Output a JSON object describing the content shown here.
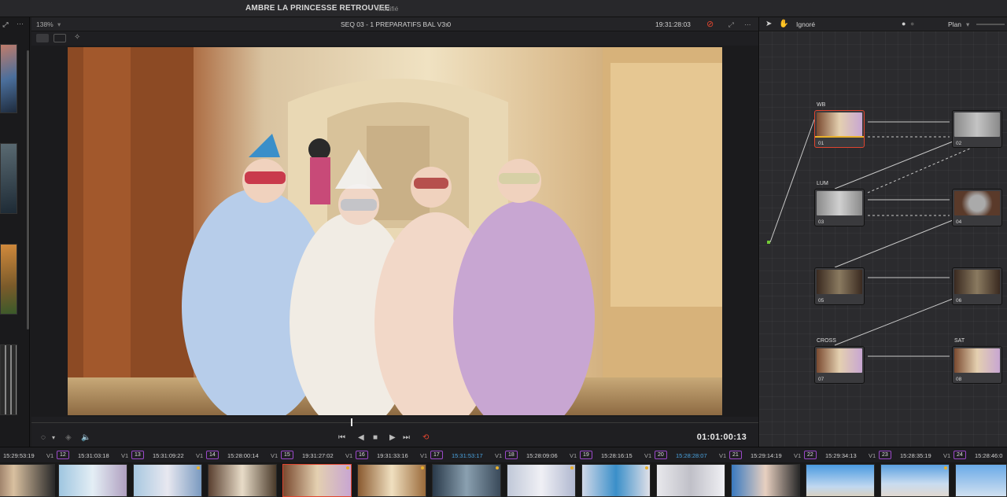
{
  "app": {
    "project_title": "AMBRE LA PRINCESSE RETROUVEE",
    "status": "Modifié"
  },
  "viewer": {
    "zoom": "138%",
    "clip_name": "SEQ 03 - 1 PREPARATIFS BAL V3.0",
    "source_timecode": "19:31:28:03",
    "record_timecode": "01:01:00:13"
  },
  "node_editor": {
    "mode": "Ignoré",
    "view": "Plan"
  },
  "nodes": [
    {
      "id": "01",
      "label": "WB",
      "selected": true
    },
    {
      "id": "02",
      "label": ""
    },
    {
      "id": "03",
      "label": "LUM"
    },
    {
      "id": "04",
      "label": ""
    },
    {
      "id": "05",
      "label": ""
    },
    {
      "id": "06",
      "label": ""
    },
    {
      "id": "07",
      "label": "CROSS"
    },
    {
      "id": "08",
      "label": "SAT"
    }
  ],
  "clips": [
    {
      "timecode": "15:29:53:19",
      "track": "V1",
      "number": "12"
    },
    {
      "timecode": "15:31:03:18",
      "track": "V1",
      "number": "13"
    },
    {
      "timecode": "15:31:09:22",
      "track": "V1",
      "number": "14"
    },
    {
      "timecode": "15:28:00:14",
      "track": "V1",
      "number": "15"
    },
    {
      "timecode": "19:31:27:02",
      "track": "V1",
      "number": "16"
    },
    {
      "timecode": "19:31:33:16",
      "track": "V1",
      "number": "17"
    },
    {
      "timecode": "15:31:53:17",
      "track": "V1",
      "number": "18",
      "highlight": true
    },
    {
      "timecode": "15:28:09:06",
      "track": "V1",
      "number": "19"
    },
    {
      "timecode": "15:28:16:15",
      "track": "V1",
      "number": "20"
    },
    {
      "timecode": "15:28:28:07",
      "track": "V1",
      "number": "21",
      "highlight": true
    },
    {
      "timecode": "15:29:14:19",
      "track": "V1",
      "number": "22"
    },
    {
      "timecode": "15:29:34:13",
      "track": "V1",
      "number": "23"
    },
    {
      "timecode": "15:28:35:19",
      "track": "V1",
      "number": "24"
    },
    {
      "timecode": "15:28:46:0",
      "track": "",
      "number": ""
    }
  ],
  "colors": {
    "accent": "#e9b02b",
    "selected": "#e0452f",
    "link_green": "#73c937",
    "link_blue": "#28a9e0",
    "clip_badge": "#9b49c9",
    "highlight_tc": "#4aa3df"
  }
}
